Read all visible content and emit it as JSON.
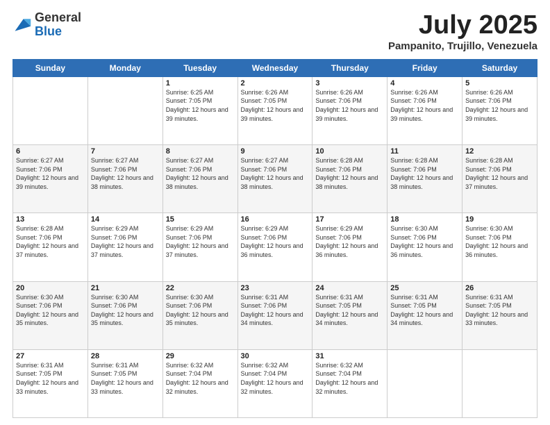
{
  "header": {
    "logo_general": "General",
    "logo_blue": "Blue",
    "month": "July 2025",
    "location": "Pampanito, Trujillo, Venezuela"
  },
  "weekdays": [
    "Sunday",
    "Monday",
    "Tuesday",
    "Wednesday",
    "Thursday",
    "Friday",
    "Saturday"
  ],
  "rows": [
    [
      {
        "num": "",
        "info": ""
      },
      {
        "num": "",
        "info": ""
      },
      {
        "num": "1",
        "info": "Sunrise: 6:25 AM\nSunset: 7:05 PM\nDaylight: 12 hours and 39 minutes."
      },
      {
        "num": "2",
        "info": "Sunrise: 6:26 AM\nSunset: 7:05 PM\nDaylight: 12 hours and 39 minutes."
      },
      {
        "num": "3",
        "info": "Sunrise: 6:26 AM\nSunset: 7:06 PM\nDaylight: 12 hours and 39 minutes."
      },
      {
        "num": "4",
        "info": "Sunrise: 6:26 AM\nSunset: 7:06 PM\nDaylight: 12 hours and 39 minutes."
      },
      {
        "num": "5",
        "info": "Sunrise: 6:26 AM\nSunset: 7:06 PM\nDaylight: 12 hours and 39 minutes."
      }
    ],
    [
      {
        "num": "6",
        "info": "Sunrise: 6:27 AM\nSunset: 7:06 PM\nDaylight: 12 hours and 39 minutes."
      },
      {
        "num": "7",
        "info": "Sunrise: 6:27 AM\nSunset: 7:06 PM\nDaylight: 12 hours and 38 minutes."
      },
      {
        "num": "8",
        "info": "Sunrise: 6:27 AM\nSunset: 7:06 PM\nDaylight: 12 hours and 38 minutes."
      },
      {
        "num": "9",
        "info": "Sunrise: 6:27 AM\nSunset: 7:06 PM\nDaylight: 12 hours and 38 minutes."
      },
      {
        "num": "10",
        "info": "Sunrise: 6:28 AM\nSunset: 7:06 PM\nDaylight: 12 hours and 38 minutes."
      },
      {
        "num": "11",
        "info": "Sunrise: 6:28 AM\nSunset: 7:06 PM\nDaylight: 12 hours and 38 minutes."
      },
      {
        "num": "12",
        "info": "Sunrise: 6:28 AM\nSunset: 7:06 PM\nDaylight: 12 hours and 37 minutes."
      }
    ],
    [
      {
        "num": "13",
        "info": "Sunrise: 6:28 AM\nSunset: 7:06 PM\nDaylight: 12 hours and 37 minutes."
      },
      {
        "num": "14",
        "info": "Sunrise: 6:29 AM\nSunset: 7:06 PM\nDaylight: 12 hours and 37 minutes."
      },
      {
        "num": "15",
        "info": "Sunrise: 6:29 AM\nSunset: 7:06 PM\nDaylight: 12 hours and 37 minutes."
      },
      {
        "num": "16",
        "info": "Sunrise: 6:29 AM\nSunset: 7:06 PM\nDaylight: 12 hours and 36 minutes."
      },
      {
        "num": "17",
        "info": "Sunrise: 6:29 AM\nSunset: 7:06 PM\nDaylight: 12 hours and 36 minutes."
      },
      {
        "num": "18",
        "info": "Sunrise: 6:30 AM\nSunset: 7:06 PM\nDaylight: 12 hours and 36 minutes."
      },
      {
        "num": "19",
        "info": "Sunrise: 6:30 AM\nSunset: 7:06 PM\nDaylight: 12 hours and 36 minutes."
      }
    ],
    [
      {
        "num": "20",
        "info": "Sunrise: 6:30 AM\nSunset: 7:06 PM\nDaylight: 12 hours and 35 minutes."
      },
      {
        "num": "21",
        "info": "Sunrise: 6:30 AM\nSunset: 7:06 PM\nDaylight: 12 hours and 35 minutes."
      },
      {
        "num": "22",
        "info": "Sunrise: 6:30 AM\nSunset: 7:06 PM\nDaylight: 12 hours and 35 minutes."
      },
      {
        "num": "23",
        "info": "Sunrise: 6:31 AM\nSunset: 7:06 PM\nDaylight: 12 hours and 34 minutes."
      },
      {
        "num": "24",
        "info": "Sunrise: 6:31 AM\nSunset: 7:05 PM\nDaylight: 12 hours and 34 minutes."
      },
      {
        "num": "25",
        "info": "Sunrise: 6:31 AM\nSunset: 7:05 PM\nDaylight: 12 hours and 34 minutes."
      },
      {
        "num": "26",
        "info": "Sunrise: 6:31 AM\nSunset: 7:05 PM\nDaylight: 12 hours and 33 minutes."
      }
    ],
    [
      {
        "num": "27",
        "info": "Sunrise: 6:31 AM\nSunset: 7:05 PM\nDaylight: 12 hours and 33 minutes."
      },
      {
        "num": "28",
        "info": "Sunrise: 6:31 AM\nSunset: 7:05 PM\nDaylight: 12 hours and 33 minutes."
      },
      {
        "num": "29",
        "info": "Sunrise: 6:32 AM\nSunset: 7:04 PM\nDaylight: 12 hours and 32 minutes."
      },
      {
        "num": "30",
        "info": "Sunrise: 6:32 AM\nSunset: 7:04 PM\nDaylight: 12 hours and 32 minutes."
      },
      {
        "num": "31",
        "info": "Sunrise: 6:32 AM\nSunset: 7:04 PM\nDaylight: 12 hours and 32 minutes."
      },
      {
        "num": "",
        "info": ""
      },
      {
        "num": "",
        "info": ""
      }
    ]
  ]
}
